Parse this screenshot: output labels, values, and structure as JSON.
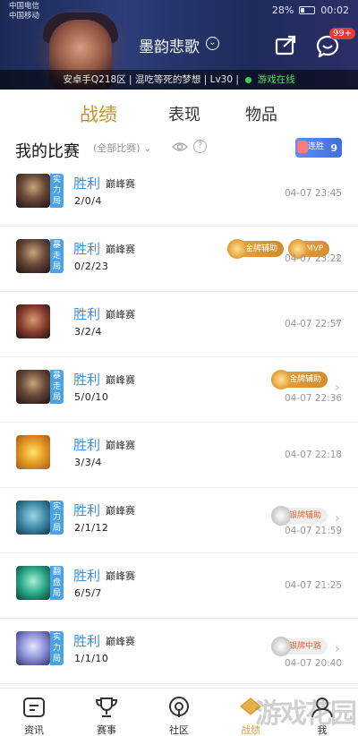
{
  "status_bar": {
    "carrier1": "中国电信",
    "carrier2": "中国移动",
    "battery": "28%",
    "time": "00:02"
  },
  "header": {
    "player_name": "墨韵悲歌",
    "notification_badge": "99+",
    "info_prefix": "安卓手Q218区 | 混吃等死的梦想 | Lv30 |",
    "online_status": "游戏在线"
  },
  "tabs": [
    {
      "label": "战绩",
      "active": true
    },
    {
      "label": "表现",
      "active": false
    },
    {
      "label": "物品",
      "active": false
    }
  ],
  "section": {
    "title": "我的比赛",
    "filter": "(全部比赛)",
    "streak_label": "连胜",
    "streak_count": "9"
  },
  "matches": [
    {
      "result": "胜利",
      "mode": "巅峰赛",
      "kda": "2/0/4",
      "time": "04-07 23:45",
      "tag": "实力局",
      "medals": []
    },
    {
      "result": "胜利",
      "mode": "巅峰赛",
      "kda": "0/2/23",
      "time": "04-07 23:22",
      "tag": "暴走局",
      "medals": [
        "金牌辅助",
        "MVP"
      ]
    },
    {
      "result": "胜利",
      "mode": "巅峰赛",
      "kda": "3/2/4",
      "time": "04-07 22:57",
      "tag": "",
      "medals": []
    },
    {
      "result": "胜利",
      "mode": "巅峰赛",
      "kda": "5/0/10",
      "time": "04-07 22:36",
      "tag": "暴走局",
      "medals": [
        "金牌辅助"
      ]
    },
    {
      "result": "胜利",
      "mode": "巅峰赛",
      "kda": "3/3/4",
      "time": "04-07 22:18",
      "tag": "",
      "medals": []
    },
    {
      "result": "胜利",
      "mode": "巅峰赛",
      "kda": "2/1/12",
      "time": "04-07 21:59",
      "tag": "实力局",
      "medals": [
        "银牌辅助"
      ]
    },
    {
      "result": "胜利",
      "mode": "巅峰赛",
      "kda": "6/5/7",
      "time": "04-07 21:25",
      "tag": "翻盘局",
      "medals": []
    },
    {
      "result": "胜利",
      "mode": "巅峰赛",
      "kda": "1/1/10",
      "time": "04-07 20:40",
      "tag": "实力局",
      "medals": [
        "银牌中路"
      ]
    }
  ],
  "bottom_nav": [
    {
      "label": "资讯",
      "icon": "news-icon",
      "active": false
    },
    {
      "label": "赛事",
      "icon": "trophy-icon",
      "active": false
    },
    {
      "label": "社区",
      "icon": "community-icon",
      "active": false
    },
    {
      "label": "战绩",
      "icon": "record-icon",
      "active": true
    },
    {
      "label": "我",
      "icon": "profile-icon",
      "active": false
    }
  ],
  "watermark": "游戏花园"
}
